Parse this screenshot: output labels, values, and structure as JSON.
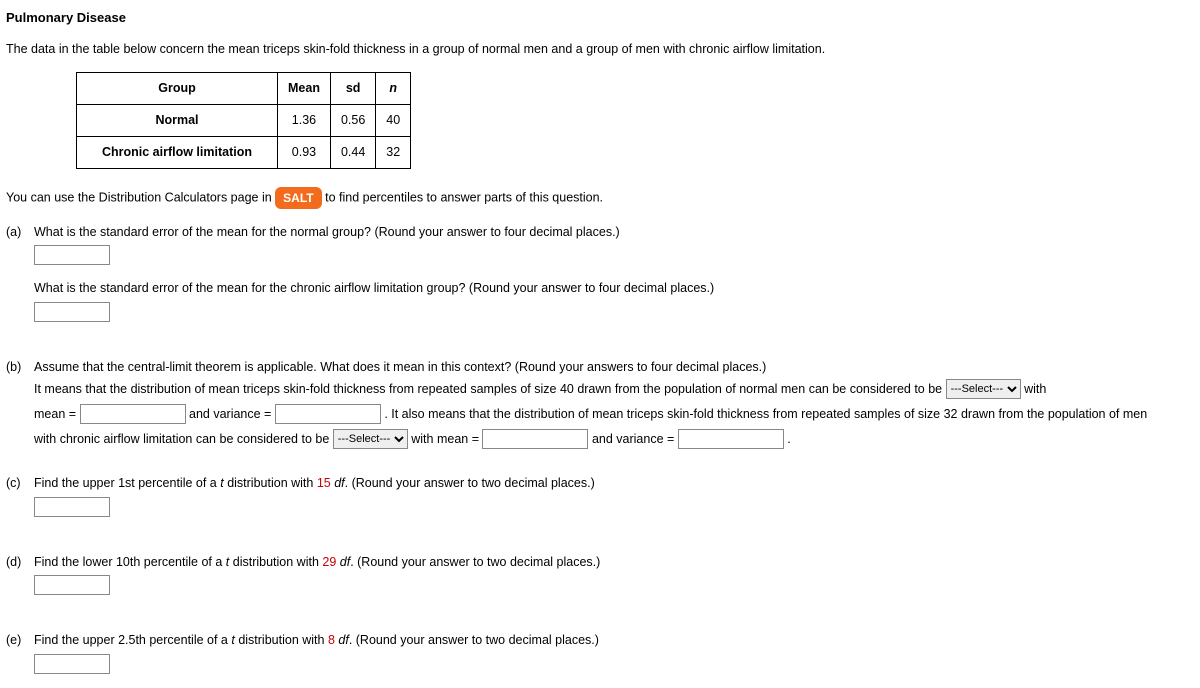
{
  "title": "Pulmonary Disease",
  "intro": "The data in the table below concern the mean triceps skin-fold thickness in a group of normal men and a group of men with chronic airflow limitation.",
  "table": {
    "headers": [
      "Group",
      "Mean",
      "sd",
      "n"
    ],
    "rows": [
      {
        "group": "Normal",
        "mean": "1.36",
        "sd": "0.56",
        "n": "40"
      },
      {
        "group": "Chronic airflow limitation",
        "mean": "0.93",
        "sd": "0.44",
        "n": "32"
      }
    ]
  },
  "salt_line_pre": "You can use the Distribution Calculators page in ",
  "salt_badge": "SALT",
  "salt_line_post": " to find percentiles to answer parts of this question.",
  "parts": {
    "a": {
      "label": "(a)",
      "q1": "What is the standard error of the mean for the normal group? (Round your answer to four decimal places.)",
      "q2": "What is the standard error of the mean for the chronic airflow limitation group? (Round your answer to four decimal places.)"
    },
    "b": {
      "label": "(b)",
      "lead": "Assume that the central-limit theorem is applicable. What does it mean in this context? (Round your answers to four decimal places.)",
      "text1": "It means that the distribution of mean triceps skin-fold thickness from repeated samples of size 40 drawn from the population of normal men can be considered to be ",
      "with": " with",
      "mean_eq": "mean = ",
      "and_var": " and variance = ",
      "text2": ". It also means that the distribution of mean triceps skin-fold thickness from repeated samples of size 32 drawn from the population of men",
      "text3": "with chronic airflow limitation can be considered to be ",
      "with_mean": " with mean = ",
      "period": ".",
      "select_placeholder": "---Select---"
    },
    "c": {
      "label": "(c)",
      "pre": "Find the upper 1st percentile of a ",
      "mid": " distribution with ",
      "df": "15",
      "post": ". (Round your answer to two decimal places.)",
      "t": "t",
      "word_df": " df"
    },
    "d": {
      "label": "(d)",
      "pre": "Find the lower 10th percentile of a ",
      "mid": " distribution with ",
      "df": "29",
      "post": ". (Round your answer to two decimal places.)",
      "t": "t",
      "word_df": " df"
    },
    "e": {
      "label": "(e)",
      "pre": "Find the upper 2.5th percentile of a ",
      "mid": " distribution with ",
      "df": "8",
      "post": ". (Round your answer to two decimal places.)",
      "t": "t",
      "word_df": " df"
    }
  }
}
